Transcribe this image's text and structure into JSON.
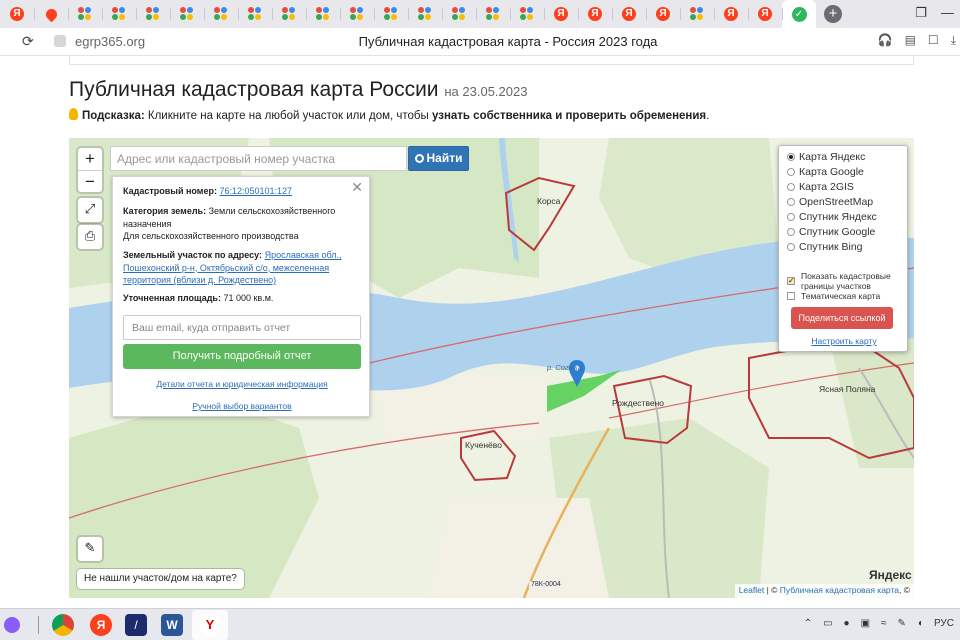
{
  "browser": {
    "tabs_favicons": [
      "yandex",
      "maps-pin",
      "dots",
      "dots",
      "dots",
      "dots",
      "dots",
      "dots",
      "dots",
      "dots",
      "dots",
      "dots",
      "dots",
      "dots",
      "dots",
      "dots",
      "yandex",
      "yandex",
      "yandex",
      "yandex",
      "dots",
      "yandex",
      "yandex",
      "check-active"
    ],
    "url": "egrp365.org",
    "page_title": "Публичная кадастровая карта - Россия 2023 года"
  },
  "page": {
    "title": "Публичная кадастровая карта России",
    "date": "на 23.05.2023",
    "hint_label": "Подсказка:",
    "hint_text": " Кликните на карте на любой участок или дом, чтобы ",
    "hint_bold": "узнать собственника и проверить обременения",
    "hint_end": "."
  },
  "map": {
    "zoom_in": "+",
    "zoom_out": "−",
    "search_placeholder": "Адрес или кадастровый номер участка",
    "search_button": "Найти",
    "labels": {
      "korsa": "Корса",
      "rozhdestveno": "Рождествено",
      "kuchenevo": "Кученёво",
      "yasnaya": "Ясная Поляна",
      "river": "р. Согожа",
      "road": "78К-0004"
    },
    "not_found": "Не нашли участок/дом на карте?",
    "attribution_leaflet": "Leaflet",
    "attribution_sep": " | © ",
    "attribution_pkk": "Публичная кадастровая карта",
    "attribution_tail": ", ©",
    "yandex_logo": "Яндекс"
  },
  "info": {
    "cad_label": "Кадастровый номер:",
    "cad_value": "76:12:050101:127",
    "category_label": "Категория земель:",
    "category_value": "Земли сельскохозяйственного назначения",
    "usage": "Для сельскохозяйственного производства",
    "address_label": "Земельный участок по адресу:",
    "address_value": "Ярославская обл., Пошехонский р-н, Октябрьский с/о, межселенная территория (вблизи д. Рождествено)",
    "area_label": "Уточненная площадь:",
    "area_value": "71 000 кв.м.",
    "email_placeholder": "Ваш email, куда отправить отчет",
    "report_button": "Получить подробный отчет",
    "details_link": "Детали отчета и юридическая информация",
    "manual_link": "Ручной выбор вариантов"
  },
  "layers": {
    "options": [
      "Карта Яндекс",
      "Карта Google",
      "Карта 2GIS",
      "OpenStreetMap",
      "Спутник Яндекс",
      "Спутник Google",
      "Спутник Bing"
    ],
    "selected": 0,
    "show_borders": "Показать кадастровые границы участков",
    "thematic": "Тематическая карта",
    "share_button": "Поделиться ссылкой",
    "setup_link": "Настроить карту"
  },
  "taskbar": {
    "tray_lang": "РУС"
  }
}
